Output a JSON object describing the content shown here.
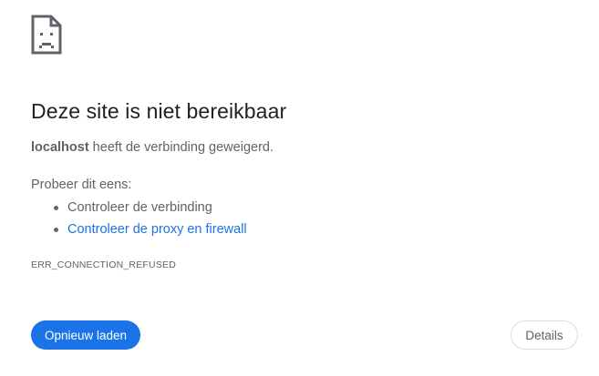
{
  "error": {
    "icon": "sad-page-icon",
    "title": "Deze site is niet bereikbaar",
    "host": "localhost",
    "message_suffix": " heeft de verbinding geweigerd.",
    "suggest_heading": "Probeer dit eens:",
    "suggestions": [
      {
        "label": "Controleer de verbinding",
        "is_link": false
      },
      {
        "label": "Controleer de proxy en firewall",
        "is_link": true
      }
    ],
    "code": "ERR_CONNECTION_REFUSED"
  },
  "buttons": {
    "reload_label": "Opnieuw laden",
    "details_label": "Details"
  },
  "colors": {
    "accent": "#1a73e8",
    "text_primary": "#202124",
    "text_secondary": "#5f6368",
    "button_border": "#dadce0"
  }
}
